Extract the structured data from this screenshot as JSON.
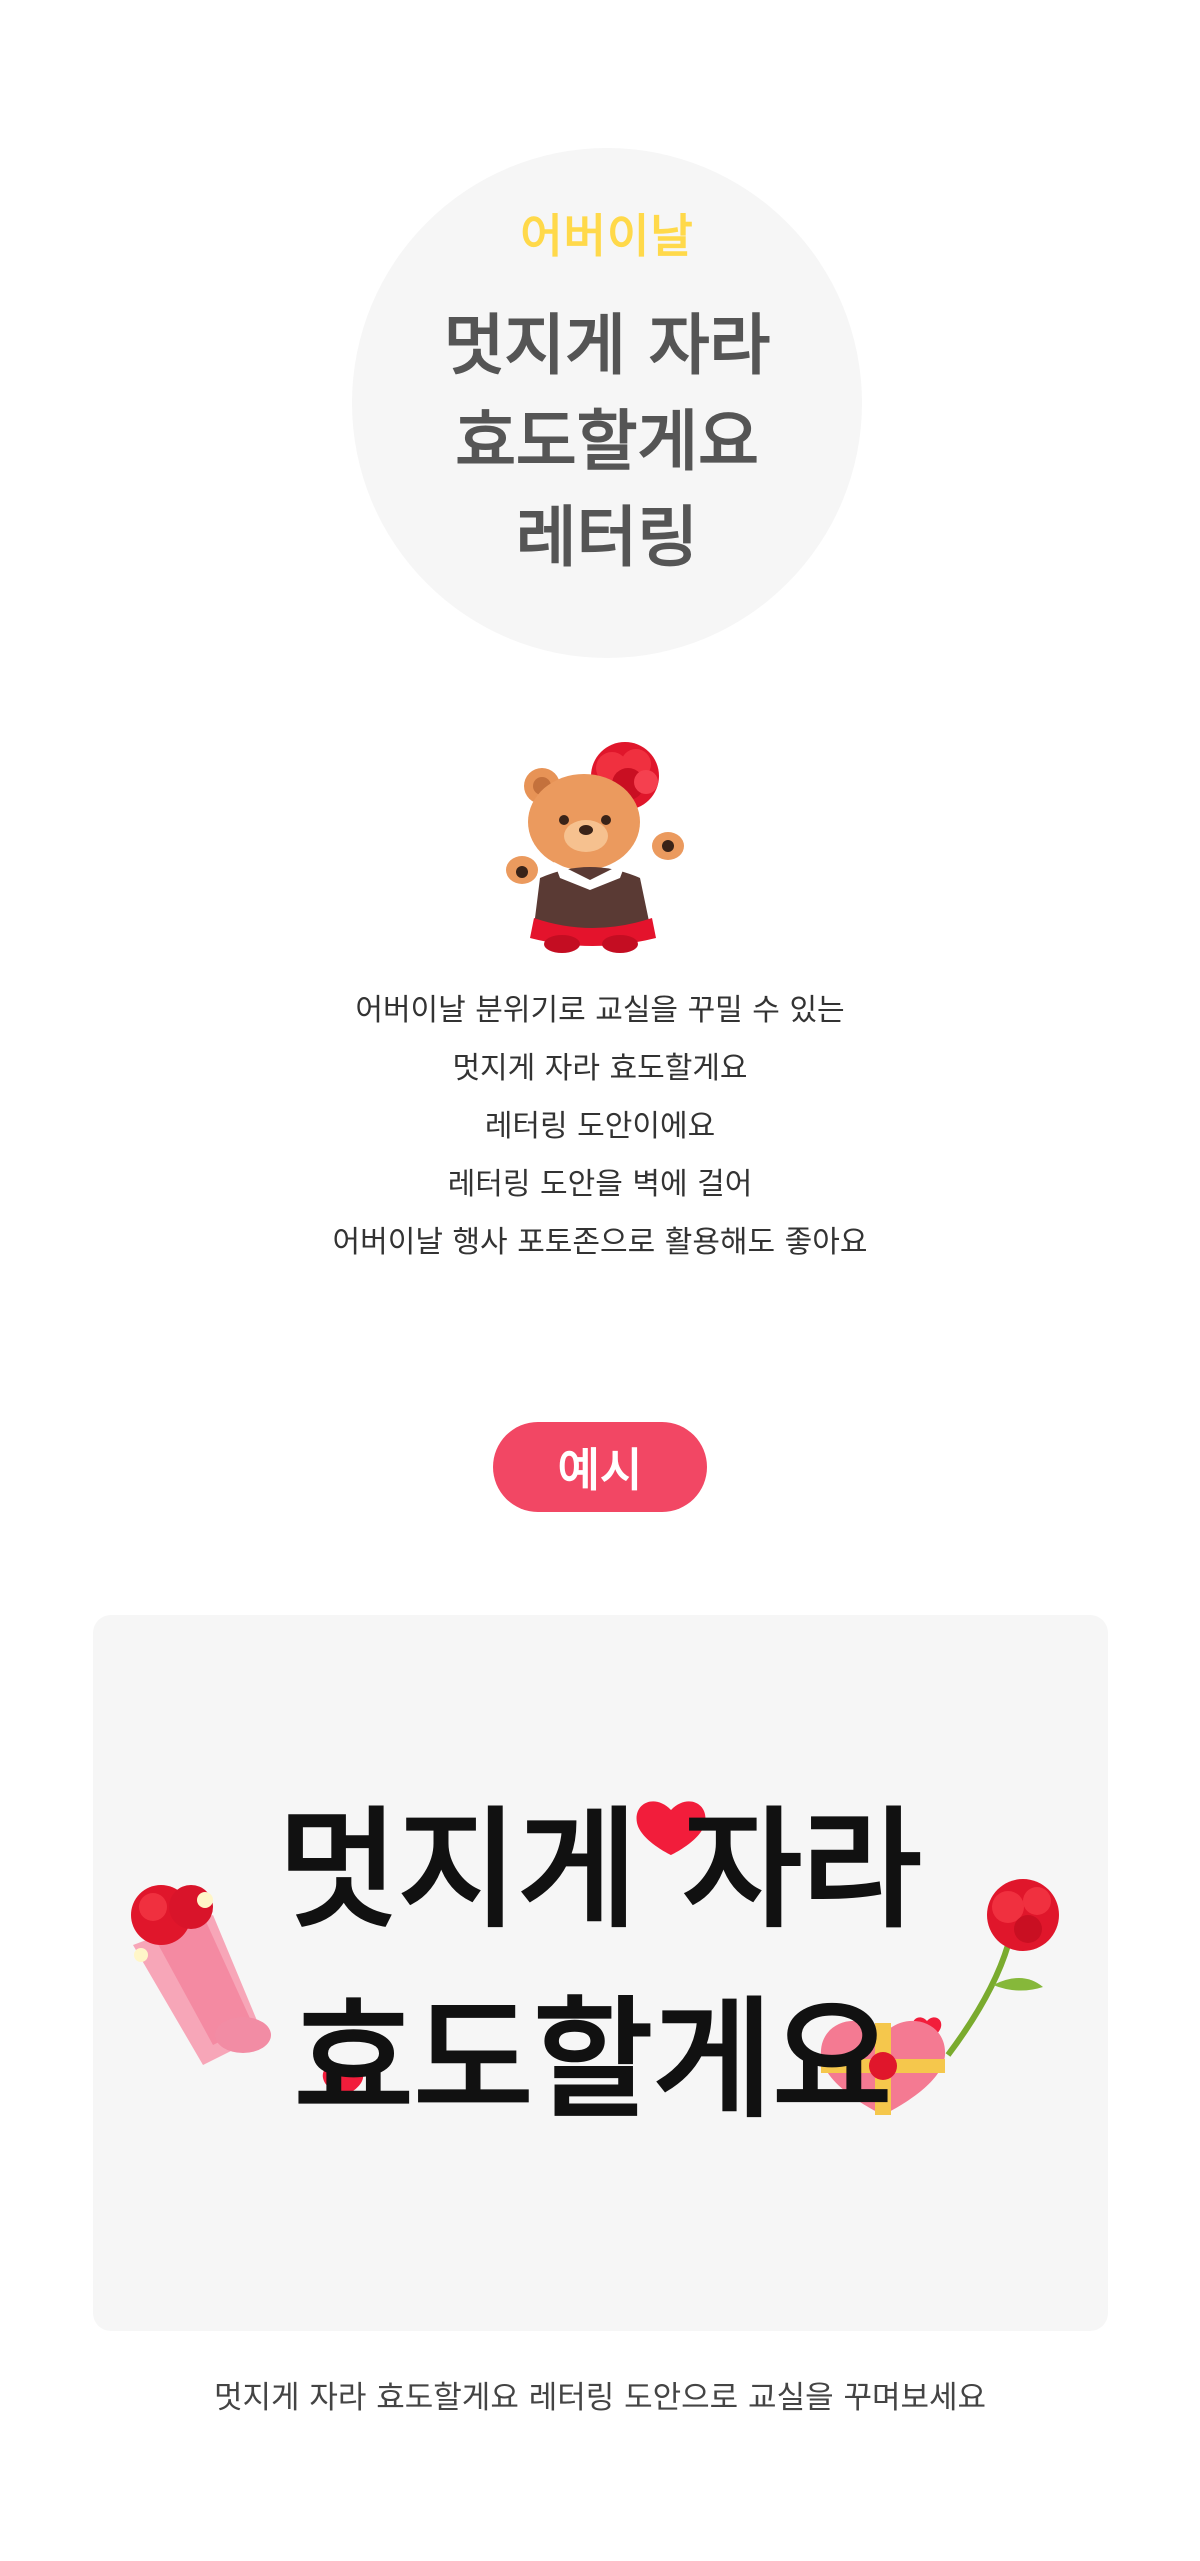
{
  "hero": {
    "eyebrow": "어버이날",
    "title_lines": [
      "멋지게 자라",
      "효도할게요",
      "레터링"
    ]
  },
  "description_lines": [
    "어버이날 분위기로 교실을 꾸밀 수 있는",
    "멋지게 자라 효도할게요",
    "레터링 도안이에요",
    "레터링 도안을 벽에 걸어",
    "어버이날 행사 포토존으로 활용해도 좋아요"
  ],
  "example": {
    "badge": "예시",
    "banner_lines": [
      "멋지게 자라",
      "효도할게요"
    ],
    "caption": "멋지게 자라 효도할게요 레터링 도안으로 교실을 꾸며보세요"
  },
  "icons": [
    "bear-with-carnation-icon",
    "bouquet-icon",
    "carnation-icon",
    "heart-icon",
    "heart-gift-box-icon"
  ],
  "colors": {
    "eyebrow": "#ffd94a",
    "title": "#555555",
    "badge": "#f24764",
    "heart": "#f21d3b",
    "panel": "#f6f6f6"
  }
}
